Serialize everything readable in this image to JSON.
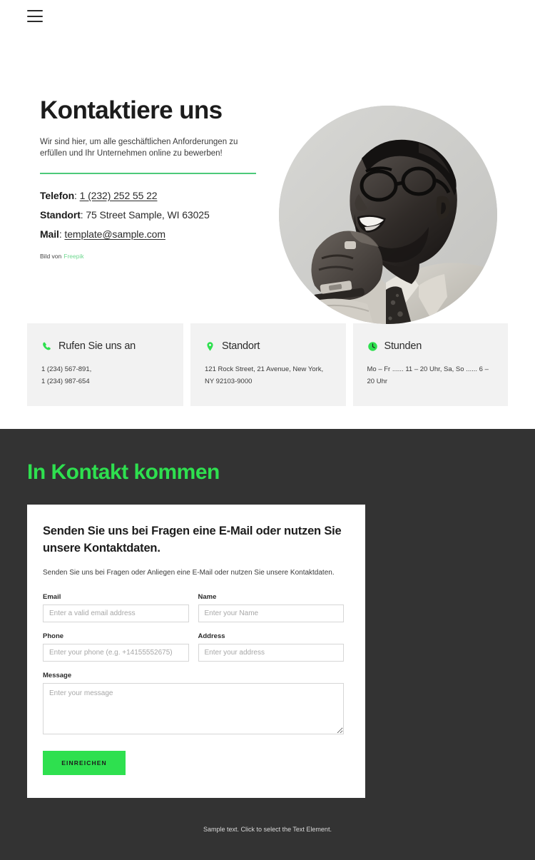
{
  "header": {
    "menu_icon": "hamburger-menu-icon"
  },
  "hero": {
    "title": "Kontaktiere uns",
    "subtitle": "Wir sind hier, um alle geschäftlichen Anforderungen zu erfüllen und Ihr Unternehmen online zu bewerben!",
    "contacts": [
      {
        "label": "Telefon",
        "separator": ": ",
        "value": "1 (232) 252 55 22",
        "link": true
      },
      {
        "label": "Standort",
        "separator": ": ",
        "value": "75 Street Sample, WI 63025",
        "link": false
      },
      {
        "label": "Mail",
        "separator": ": ",
        "value": "template@sample.com",
        "link": true
      }
    ],
    "credit_text": "Bild von",
    "credit_link": "Freepik",
    "photo_alt": "portrait-photo-man-smiling-glasses"
  },
  "cards": [
    {
      "icon": "phone-icon",
      "title": "Rufen Sie uns an",
      "body": "1 (234) 567-891,\n1 (234) 987-654"
    },
    {
      "icon": "location-pin-icon",
      "title": "Standort",
      "body": "121 Rock Street, 21 Avenue, New York, NY 92103-9000"
    },
    {
      "icon": "clock-icon",
      "title": "Stunden",
      "body": "Mo – Fr ...... 11 – 20 Uhr, Sa, So ...... 6 – 20 Uhr"
    }
  ],
  "dark_section": {
    "title": "In Kontakt kommen",
    "form": {
      "heading": "Senden Sie uns bei Fragen eine E-Mail oder nutzen Sie unsere Kontaktdaten.",
      "description": "Senden Sie uns bei Fragen oder Anliegen eine E-Mail oder nutzen Sie unsere Kontaktdaten.",
      "fields": {
        "email": {
          "label": "Email",
          "value": "",
          "placeholder": "Enter a valid email address"
        },
        "name": {
          "label": "Name",
          "value": "",
          "placeholder": "Enter your Name"
        },
        "phone": {
          "label": "Phone",
          "value": "",
          "placeholder": "Enter your phone (e.g. +14155552675)"
        },
        "address": {
          "label": "Address",
          "value": "",
          "placeholder": "Enter your address"
        },
        "message": {
          "label": "Message",
          "value": "",
          "placeholder": "Enter your message"
        }
      },
      "submit_label": "EINREICHEN"
    },
    "footer_note": "Sample text. Click to select the Text Element."
  },
  "colors": {
    "accent_green": "#2ee04f",
    "rule_green": "#4cc97a",
    "credit_green": "#6fd890",
    "dark_bg": "#333333",
    "card_bg": "#f2f2f2",
    "text_dark": "#1c1c1c"
  }
}
